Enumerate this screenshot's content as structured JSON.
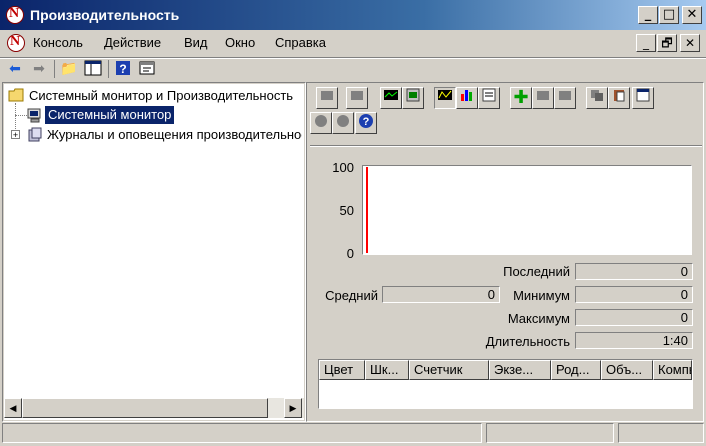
{
  "window": {
    "title": "Производительность",
    "buttons": [
      "_",
      "□",
      "✕"
    ]
  },
  "menu": {
    "items": [
      "Консоль",
      "Действие",
      "Вид",
      "Окно",
      "Справка"
    ],
    "mdi_buttons": [
      "_",
      "🗗",
      "✕"
    ]
  },
  "toolbar": {
    "icons": [
      "back-arrow-icon",
      "forward-arrow-icon",
      "up-folder-icon",
      "show-hide-tree-icon",
      "help-icon",
      "properties-icon"
    ]
  },
  "tree": {
    "root": "Системный монитор и Производительность",
    "items": [
      {
        "label": "Системный монитор",
        "selected": true
      },
      {
        "label": "Журналы и оповещения производительности",
        "expandable": true
      }
    ],
    "expander": "+"
  },
  "sysmon": {
    "help_glyph": "?",
    "graph": {
      "y_ticks": [
        "100",
        "50",
        "0"
      ],
      "line_color": "#ff0000",
      "background": "#ffffff"
    },
    "stats": {
      "last_label": "Последний",
      "last_value": "0",
      "avg_label": "Средний",
      "avg_value": "0",
      "min_label": "Минимум",
      "min_value": "0",
      "max_label": "Максимум",
      "max_value": "0",
      "duration_label": "Длительность",
      "duration_value": "1:40"
    },
    "columns": [
      "Цвет",
      "Шк...",
      "Счетчик",
      "Экзе...",
      "Род...",
      "Объ...",
      "Компьютер"
    ]
  },
  "colors": {
    "title_start": "#0a246a",
    "selection": "#0a246a",
    "face": "#d4d0c8"
  }
}
